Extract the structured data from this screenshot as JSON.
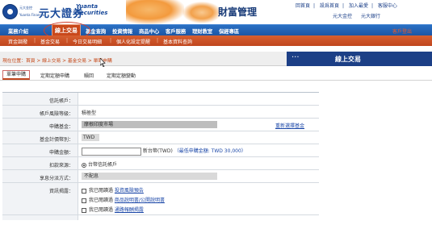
{
  "header": {
    "logo_en1": "元大金控",
    "logo_en2": "Yuanta Financial",
    "logo_zh": "元大證券",
    "logo_yu": "Yuanta Securities",
    "brand_title": "財富管理",
    "top_links": [
      "回首頁",
      "設爲首頁",
      "加入最愛",
      "客服中心"
    ],
    "sub_links": [
      "元大金控",
      "元大銀行"
    ]
  },
  "main_nav": {
    "items": [
      "業務介紹",
      "線上交易",
      "基金查詢",
      "投資情報",
      "商品中心",
      "客戶服務",
      "理財教室",
      "保經專區"
    ],
    "active": "線上交易",
    "login": "客戶登出"
  },
  "sub_nav": {
    "items": [
      "資金調撥",
      "基金交易",
      "今日交易明細",
      "個人化設定提醒",
      "基本資料查詢"
    ]
  },
  "breadcrumb": {
    "text": "現在位置：首頁 > 線上交易 > 基金交易 > 單筆申購"
  },
  "banner": {
    "title": "線上交易"
  },
  "tabs": {
    "items": [
      "單筆申購",
      "定期定額申購",
      "贖回",
      "定期定額變動"
    ],
    "active": "單筆申購"
  },
  "form": {
    "rows": [
      {
        "label": "信託帳戶：",
        "value": ""
      },
      {
        "label": "帳戶風險等級：",
        "value": "積極型"
      },
      {
        "label": "申購基金：",
        "value": "摩根印度市場",
        "link": "重新選擇基金"
      },
      {
        "label": "基金計價幣別：",
        "value": "TWD"
      },
      {
        "label": "申購金額：",
        "value": "新台幣(TWD)",
        "note": "（最低申購金額: TWD 30,000）"
      },
      {
        "label": "扣款來源：",
        "value": "台幣信託帳戶"
      },
      {
        "label": "享息分派方式：",
        "value": "不配息"
      },
      {
        "label": "資訊揭露：",
        "items": [
          "我已閱讀過 投資風險預告",
          "我已閱讀過 商品說明書/公開說明書",
          "我已閱讀過 通路報酬揭露"
        ],
        "links": [
          "投資風險預告",
          "商品說明書/公開說明書",
          "通路報酬揭露"
        ]
      },
      {
        "label": "",
        "value": ""
      }
    ]
  },
  "colors": {
    "nav_blue": "#1c56a5",
    "accent_orange": "#c9481b",
    "banner_navy": "#1c3f86",
    "link_blue": "#1c48a8"
  }
}
